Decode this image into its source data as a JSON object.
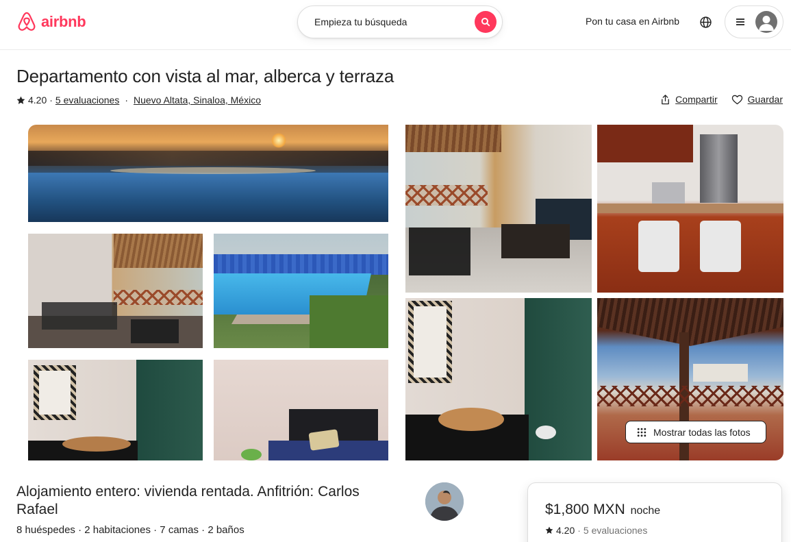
{
  "header": {
    "logo_text": "airbnb",
    "search_placeholder": "Empieza tu búsqueda",
    "host_link": "Pon tu casa en Airbnb"
  },
  "listing": {
    "title": "Departamento con vista al mar, alberca y terraza",
    "rating": "4.20",
    "separator": "·",
    "reviews": "5 evaluaciones",
    "location": "Nuevo Altata, Sinaloa, México",
    "share_label": "Compartir",
    "save_label": "Guardar",
    "show_all_photos": "Mostrar todas las fotos",
    "subtitle": "Alojamiento entero: vivienda rentada. Anfitrión: Carlos Rafael",
    "details": "8 huéspedes · 2 habitaciones · 7 camas · 2 baños"
  },
  "booking": {
    "price": "$1,800 MXN",
    "per": "noche",
    "rating": "4.20",
    "separator": "·",
    "reviews": "5 evaluaciones"
  },
  "colors": {
    "brand": "#ff385c",
    "text": "#222222",
    "muted": "#717171",
    "border": "#dddddd"
  }
}
